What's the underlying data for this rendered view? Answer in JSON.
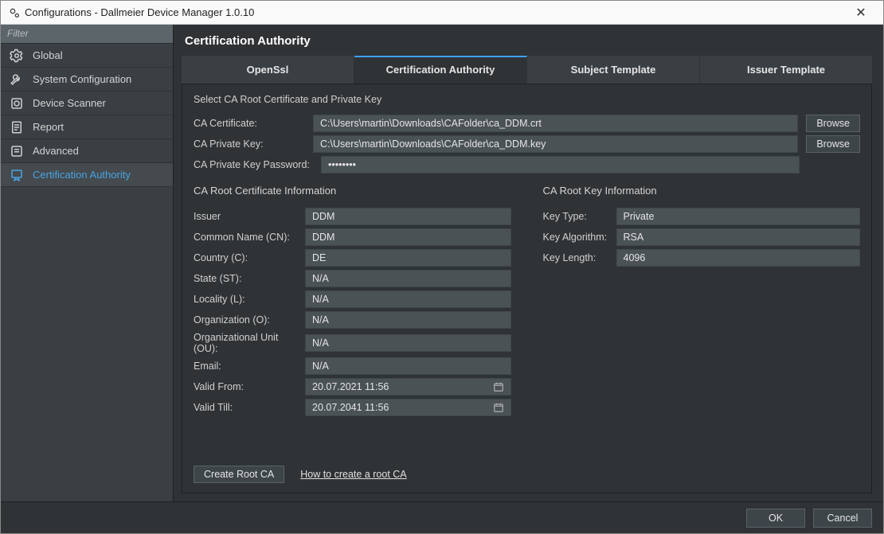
{
  "window": {
    "title": "Configurations - Dallmeier Device Manager 1.0.10"
  },
  "sidebar": {
    "filter_placeholder": "Filter",
    "items": [
      {
        "label": "Global"
      },
      {
        "label": "System Configuration"
      },
      {
        "label": "Device Scanner"
      },
      {
        "label": "Report"
      },
      {
        "label": "Advanced"
      },
      {
        "label": "Certification Authority"
      }
    ]
  },
  "page": {
    "title": "Certification Authority"
  },
  "tabs": [
    {
      "label": "OpenSsl"
    },
    {
      "label": "Certification Authority"
    },
    {
      "label": "Subject Template"
    },
    {
      "label": "Issuer Template"
    }
  ],
  "select_section": {
    "title": "Select CA Root Certificate and Private Key",
    "ca_cert_label": "CA Certificate:",
    "ca_cert_value": "C:\\Users\\martin\\Downloads\\CAFolder\\ca_DDM.crt",
    "ca_key_label": "CA Private Key:",
    "ca_key_value": "C:\\Users\\martin\\Downloads\\CAFolder\\ca_DDM.key",
    "ca_pw_label": "CA Private Key Password:",
    "ca_pw_value": "••••••••",
    "browse": "Browse"
  },
  "cert_info": {
    "title": "CA Root Certificate Information",
    "issuer_label": "Issuer",
    "issuer": "DDM",
    "cn_label": "Common Name (CN):",
    "cn": "DDM",
    "c_label": "Country (C):",
    "c": "DE",
    "st_label": "State (ST):",
    "st": "N/A",
    "l_label": "Locality (L):",
    "l": "N/A",
    "o_label": "Organization (O):",
    "o": "N/A",
    "ou_label": "Organizational Unit (OU):",
    "ou": "N/A",
    "email_label": "Email:",
    "email": "N/A",
    "from_label": "Valid From:",
    "from": "20.07.2021 11:56",
    "till_label": "Valid Till:",
    "till": "20.07.2041 11:56"
  },
  "key_info": {
    "title": "CA Root Key Information",
    "type_label": "Key Type:",
    "type": "Private",
    "alg_label": "Key Algorithm:",
    "alg": "RSA",
    "len_label": "Key Length:",
    "len": "4096"
  },
  "actions": {
    "create_root": "Create Root CA",
    "howto": "How to create a root CA"
  },
  "footer": {
    "ok": "OK",
    "cancel": "Cancel"
  }
}
